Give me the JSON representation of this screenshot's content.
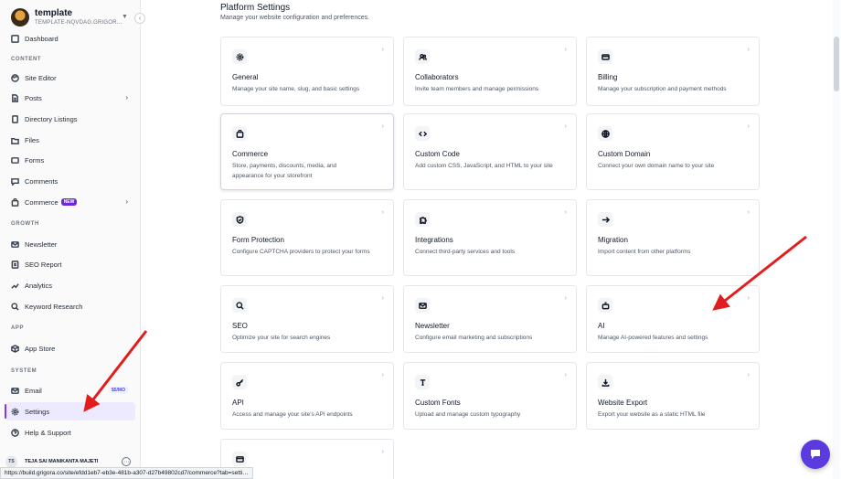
{
  "brand": {
    "name": "template",
    "subdomain": "TEMPLATE-NQVDAG.GRIGOR…"
  },
  "sidebar": {
    "top_item": "Dashboard",
    "sections": {
      "content": "CONTENT",
      "growth": "GROWTH",
      "app": "APP",
      "system": "SYSTEM"
    },
    "items": {
      "site_editor": "Site Editor",
      "posts": "Posts",
      "directory": "Directory Listings",
      "files": "Files",
      "forms": "Forms",
      "comments": "Comments",
      "commerce": "Commerce",
      "commerce_badge": "NEW",
      "newsletter": "Newsletter",
      "seo_report": "SEO Report",
      "analytics": "Analytics",
      "keyword": "Keyword Research",
      "app_store": "App Store",
      "email": "Email",
      "email_badge": "$5/MO",
      "settings": "Settings",
      "help": "Help & Support"
    },
    "user": {
      "initials": "TS",
      "name": "TEJA SAI MANIKANTA MAJETI"
    }
  },
  "main": {
    "title": "Platform Settings",
    "subtitle": "Manage your website configuration and preferences.",
    "cards": {
      "general": {
        "title": "General",
        "desc": "Manage your site name, slug, and basic settings"
      },
      "collaborators": {
        "title": "Collaborators",
        "desc": "Invite team members and manage permissions"
      },
      "billing": {
        "title": "Billing",
        "desc": "Manage your subscription and payment methods"
      },
      "commerce": {
        "title": "Commerce",
        "desc": "Store, payments, discounts, media, and appearance for your storefront"
      },
      "custom_code": {
        "title": "Custom Code",
        "desc": "Add custom CSS, JavaScript, and HTML to your site"
      },
      "custom_domain": {
        "title": "Custom Domain",
        "desc": "Connect your own domain name to your site"
      },
      "form_protection": {
        "title": "Form Protection",
        "desc": "Configure CAPTCHA providers to protect your forms"
      },
      "integrations": {
        "title": "Integrations",
        "desc": "Connect third-party services and tools"
      },
      "migration": {
        "title": "Migration",
        "desc": "Import content from other platforms"
      },
      "seo": {
        "title": "SEO",
        "desc": "Optimize your site for search engines"
      },
      "newsletter": {
        "title": "Newsletter",
        "desc": "Configure email marketing and subscriptions"
      },
      "ai": {
        "title": "AI",
        "desc": "Manage AI-powered features and settings"
      },
      "api": {
        "title": "API",
        "desc": "Access and manage your site's API endpoints"
      },
      "custom_fonts": {
        "title": "Custom Fonts",
        "desc": "Upload and manage custom typography"
      },
      "website_export": {
        "title": "Website Export",
        "desc": "Export your website as a static HTML file"
      }
    },
    "card_arrow": "›"
  },
  "status_bar": {
    "url": "https://build.grigora.co/site/efdd1eb7-eb3e-481b-a307-d27b49802cd7/commerce?tab=setti…"
  },
  "colors": {
    "accent": "#7c3aed",
    "annotation_arrow": "#e11d1d",
    "chat": "#5b3bdf"
  }
}
